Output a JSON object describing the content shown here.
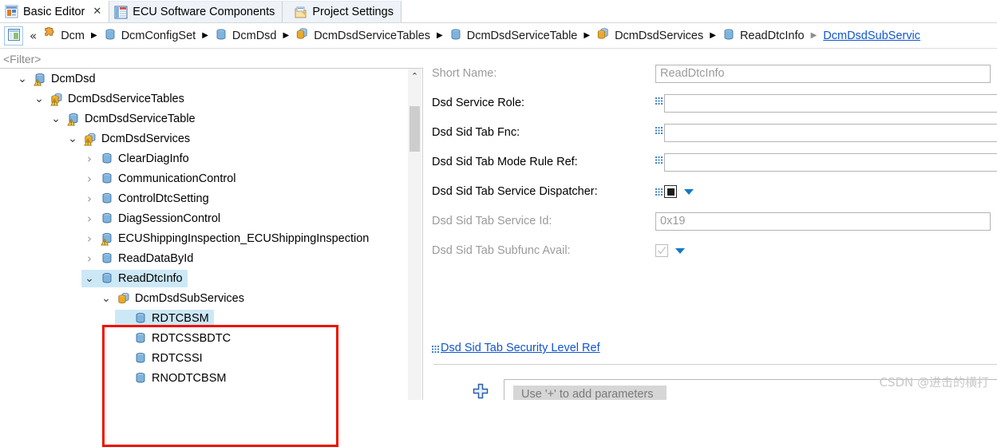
{
  "tabs": [
    {
      "label": "Basic Editor",
      "icon": "basic-editor-icon",
      "active": true,
      "closable": true,
      "close_glyph": "✕"
    },
    {
      "label": "ECU Software Components",
      "icon": "ecu-software-components-icon",
      "active": false,
      "closable": false
    },
    {
      "label": "Project Settings",
      "icon": "project-settings-icon",
      "active": false,
      "closable": false
    }
  ],
  "breadcrumb": {
    "home_icon": "editor-home-icon",
    "overflow_glyph": "«",
    "separator": "▶",
    "items": [
      {
        "label": "Dcm",
        "icon": "puzzle-icon",
        "link": false
      },
      {
        "label": "DcmConfigSet",
        "icon": "container-icon",
        "link": false
      },
      {
        "label": "DcmDsd",
        "icon": "container-icon",
        "link": false
      },
      {
        "label": "DcmDsdServiceTables",
        "icon": "container-multi-icon",
        "link": false
      },
      {
        "label": "DcmDsdServiceTable",
        "icon": "container-icon",
        "link": false
      },
      {
        "label": "DcmDsdServices",
        "icon": "container-multi-icon",
        "link": false
      },
      {
        "label": "ReadDtcInfo",
        "icon": "container-icon",
        "link": false
      },
      {
        "label": "DcmDsdSubServic",
        "icon": "none",
        "link": true
      }
    ]
  },
  "tree": {
    "filter_placeholder": "<Filter>",
    "scroll_up_glyph": "⌃",
    "expanded_glyph": "⌄",
    "collapsed_glyph": "›",
    "nodes": [
      {
        "label": "DcmDsd",
        "indent": 1,
        "state": "expanded",
        "icon": "container-warning-icon",
        "selected": false
      },
      {
        "label": "DcmDsdServiceTables",
        "indent": 2,
        "state": "expanded",
        "icon": "container-multi-warning-icon",
        "selected": false
      },
      {
        "label": "DcmDsdServiceTable",
        "indent": 3,
        "state": "expanded",
        "icon": "container-warning-icon",
        "selected": false
      },
      {
        "label": "DcmDsdServices",
        "indent": 4,
        "state": "expanded",
        "icon": "container-multi-warning-icon",
        "selected": false
      },
      {
        "label": "ClearDiagInfo",
        "indent": 5,
        "state": "collapsed",
        "icon": "container-icon",
        "selected": false
      },
      {
        "label": "CommunicationControl",
        "indent": 5,
        "state": "collapsed",
        "icon": "container-icon",
        "selected": false
      },
      {
        "label": "ControlDtcSetting",
        "indent": 5,
        "state": "collapsed",
        "icon": "container-icon",
        "selected": false
      },
      {
        "label": "DiagSessionControl",
        "indent": 5,
        "state": "collapsed",
        "icon": "container-icon",
        "selected": false
      },
      {
        "label": "ECUShippingInspection_ECUShippingInspection",
        "indent": 5,
        "state": "collapsed",
        "icon": "container-warning-icon",
        "selected": false
      },
      {
        "label": "ReadDataById",
        "indent": 5,
        "state": "collapsed",
        "icon": "container-icon",
        "selected": false
      },
      {
        "label": "ReadDtcInfo",
        "indent": 5,
        "state": "expanded",
        "icon": "container-icon",
        "selected": true
      },
      {
        "label": "DcmDsdSubServices",
        "indent": 6,
        "state": "expanded",
        "icon": "container-multi-icon",
        "selected": false
      },
      {
        "label": "RDTCBSM",
        "indent": 7,
        "state": "leaf",
        "icon": "container-icon",
        "selected": true
      },
      {
        "label": "RDTCSSBDTC",
        "indent": 7,
        "state": "leaf",
        "icon": "container-icon",
        "selected": false
      },
      {
        "label": "RDTCSSI",
        "indent": 7,
        "state": "leaf",
        "icon": "container-icon",
        "selected": false
      },
      {
        "label": "RNODTCBSM",
        "indent": 7,
        "state": "leaf",
        "icon": "container-icon",
        "selected": false
      }
    ]
  },
  "form": {
    "fields": [
      {
        "label": "Short Name:",
        "dim": true,
        "control": "text",
        "value": "ReadDtcInfo",
        "link_marker": false
      },
      {
        "label": "Dsd Service Role:",
        "dim": false,
        "control": "text",
        "value": "",
        "link_marker": true
      },
      {
        "label": "Dsd Sid Tab Fnc:",
        "dim": false,
        "control": "text",
        "value": "",
        "link_marker": true
      },
      {
        "label": "Dsd Sid Tab Mode Rule Ref:",
        "dim": false,
        "control": "text",
        "value": "",
        "link_marker": true
      },
      {
        "label": "Dsd Sid Tab Service Dispatcher:",
        "dim": false,
        "control": "checkbox-filled",
        "value": "",
        "link_marker": true
      },
      {
        "label": "Dsd Sid Tab Service Id:",
        "dim": true,
        "control": "text",
        "value": "0x19",
        "link_marker": false
      },
      {
        "label": "Dsd Sid Tab Subfunc Avail:",
        "dim": true,
        "control": "checkbox-dim",
        "value": "",
        "link_marker": false
      }
    ],
    "security_section": {
      "link_label": "Dsd Sid Tab Security Level Ref",
      "link_marker": true,
      "add_icon": "plus-icon",
      "remove_icon": "remove-x-icon",
      "empty_hint": "Use '+' to add parameters"
    }
  },
  "watermark": {
    "text": "CSDN @进击的横打"
  },
  "colors": {
    "selection_blue": "#cce8f6",
    "link_blue": "#1155cc",
    "annotation_red": "#ee1100",
    "accent_blue": "#1478c8",
    "disabled_gray": "#9b9b9b"
  }
}
